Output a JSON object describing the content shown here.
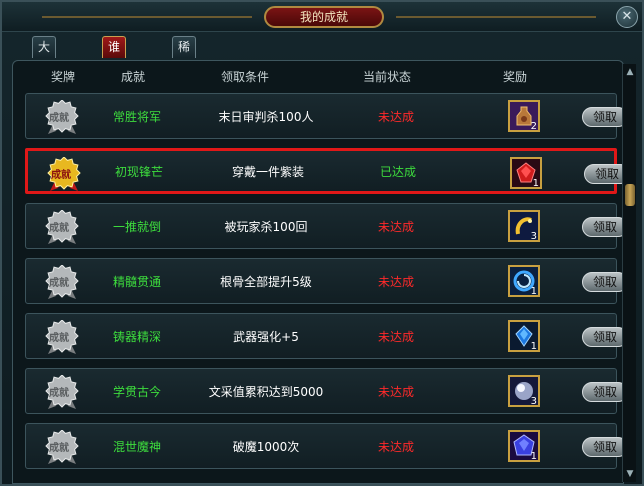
{
  "window": {
    "title": "我的成就",
    "close": "✕"
  },
  "tabs": [
    {
      "label": "大汉江山",
      "active": false
    },
    {
      "label": "谁与争锋",
      "active": true
    },
    {
      "label": "稀世奇珍",
      "active": false
    }
  ],
  "columns": {
    "medal": "奖牌",
    "achievement": "成就",
    "condition": "领取条件",
    "status": "当前状态",
    "reward": "奖励"
  },
  "medal_text": "成就",
  "claim_label": "领取",
  "rows": [
    {
      "name": "常胜将军",
      "condition": "末日审判杀100人",
      "status": "未达成",
      "done": false,
      "reward_icon": "potion-jar-icon",
      "reward_count": "2",
      "highlight": false
    },
    {
      "name": "初现锋芒",
      "condition": "穿戴一件紫装",
      "status": "已达成",
      "done": true,
      "reward_icon": "red-gem-icon",
      "reward_count": "1",
      "highlight": true
    },
    {
      "name": "一推就倒",
      "condition": "被玩家杀100回",
      "status": "未达成",
      "done": false,
      "reward_icon": "gold-ring-icon",
      "reward_count": "3",
      "highlight": false
    },
    {
      "name": "精髓贯通",
      "condition": "根骨全部提升5级",
      "status": "未达成",
      "done": false,
      "reward_icon": "blue-swirl-icon",
      "reward_count": "1",
      "highlight": false
    },
    {
      "name": "铸器精深",
      "condition": "武器强化+5",
      "status": "未达成",
      "done": false,
      "reward_icon": "blue-gem-icon",
      "reward_count": "1",
      "highlight": false
    },
    {
      "name": "学贯古今",
      "condition": "文采值累积达到5000",
      "status": "未达成",
      "done": false,
      "reward_icon": "pearl-orb-icon",
      "reward_count": "3",
      "highlight": false
    },
    {
      "name": "混世魔神",
      "condition": "破魔1000次",
      "status": "未达成",
      "done": false,
      "reward_icon": "sapphire-icon",
      "reward_count": "1",
      "highlight": false
    }
  ],
  "colors": {
    "achieved": "#3ddc3d",
    "not_achieved": "#ff2a2a",
    "highlight_border": "#e01818"
  }
}
